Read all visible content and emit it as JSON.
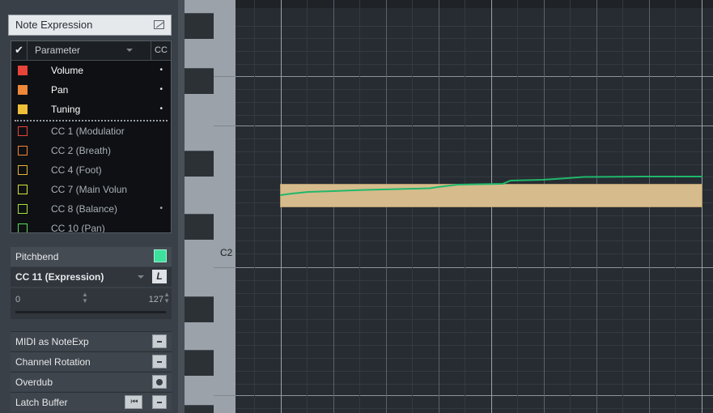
{
  "inspector": {
    "section_title": "Note Expression",
    "table_header": {
      "check": "✔",
      "parameter": "Parameter",
      "cc": "CC"
    },
    "active_params": [
      {
        "label": "Volume",
        "color": "#e8443a",
        "dot": "•"
      },
      {
        "label": "Pan",
        "color": "#f0873a",
        "dot": "•"
      },
      {
        "label": "Tuning",
        "color": "#f0bf3a",
        "dot": "•"
      }
    ],
    "inactive_params": [
      {
        "label": "CC 1  (Modulatior",
        "color": "#e8443a"
      },
      {
        "label": "CC 2  (Breath)",
        "color": "#f0873a"
      },
      {
        "label": "CC 4  (Foot)",
        "color": "#e8b53a"
      },
      {
        "label": "CC 7  (Main Volun",
        "color": "#d8e23a"
      },
      {
        "label": "CC 8  (Balance)",
        "color": "#a6e23a",
        "dot": "•"
      },
      {
        "label": "CC 10  (Pan)",
        "color": "#58e05a"
      }
    ],
    "pitchbend": {
      "label": "Pitchbend",
      "color": "#3ee09e"
    },
    "cc_select": {
      "label": "CC 11  (Expression)",
      "button": "L"
    },
    "range": {
      "min": "0",
      "max": "127"
    },
    "options": [
      {
        "label": "MIDI as NoteExp",
        "button": "dash"
      },
      {
        "label": "Channel Rotation",
        "button": "dash"
      },
      {
        "label": "Overdub",
        "button": "rec"
      },
      {
        "label": "Latch Buffer",
        "button": "dash",
        "extra": "⏮"
      }
    ]
  },
  "keyboard": {
    "label": "C2"
  },
  "editor": {
    "note_color": "#d6bb8c",
    "curve_color": "#1fb86b"
  }
}
